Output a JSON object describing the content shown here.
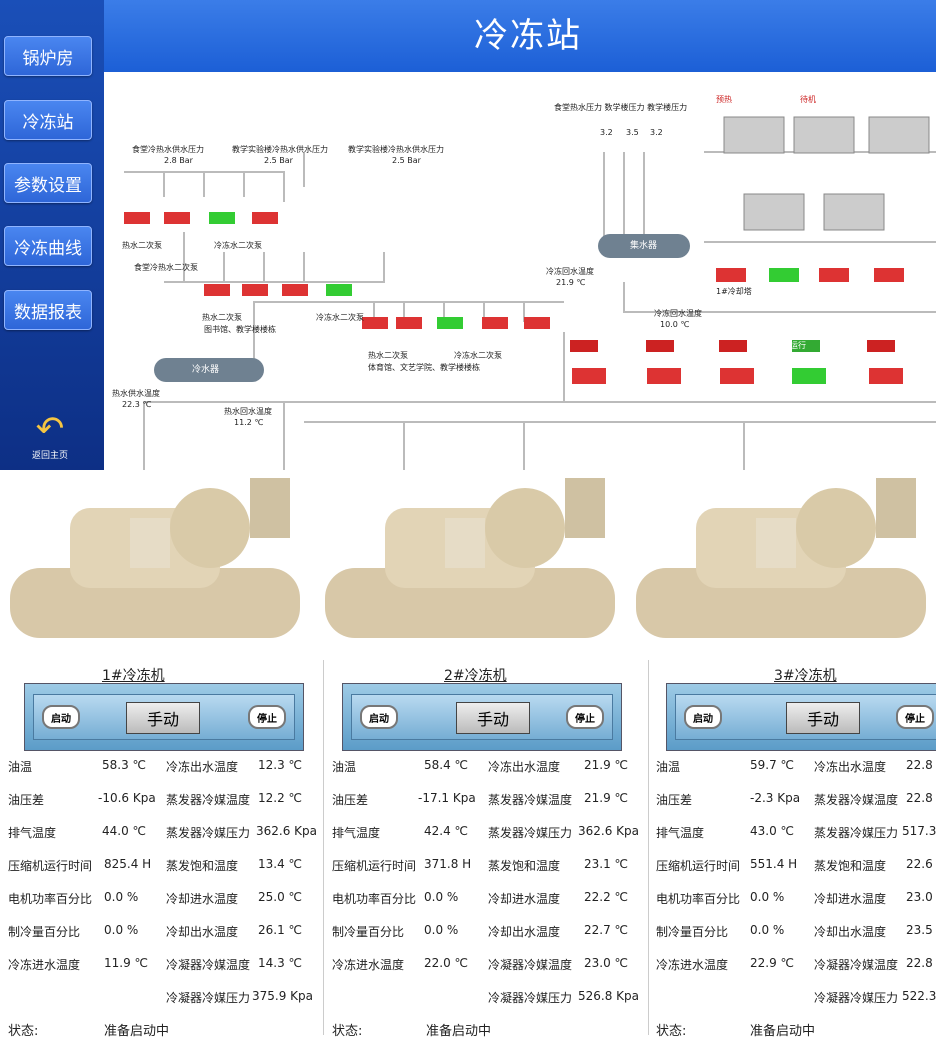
{
  "header": {
    "title": "冷冻站"
  },
  "nav": {
    "items": [
      {
        "label": "锅炉房"
      },
      {
        "label": "冷冻站"
      },
      {
        "label": "参数设置"
      },
      {
        "label": "冷冻曲线"
      },
      {
        "label": "数据报表"
      }
    ],
    "back_label": "返回主页"
  },
  "diagram": {
    "labels": {
      "cold_tank": "冷水器",
      "hot_tank": "集水器",
      "top_p1": "食堂冷热水供水压力",
      "top_p1_val": "2.8  Bar",
      "top_p2": "教学实验楼冷热水供水压力",
      "top_p2_val": "2.5  Bar",
      "top_p3": "教学实验楼冷热水供水压力",
      "top_p3_val": "2.5  Bar",
      "right_top": "食堂热水压力  数学楼压力  教学楼压力",
      "p_a": "3.2",
      "p_b": "3.5",
      "p_c": "3.2",
      "bar": "Bar",
      "pump_group1": "热水二次泵",
      "pump_group2": "冷冻水二次泵",
      "pump_group3": "食堂冷热水二次泵",
      "pump_group4": "热水二次泵",
      "pump_group5": "冷冻水二次泵",
      "pump_group6": "图书馆、教学楼楼栋",
      "pump_group7": "热水二次泵",
      "pump_group8": "冷冻水二次泵",
      "pump_group9": "体育馆、文艺学院、教学楼楼栋",
      "return_temp": "冷冻回水温度",
      "return_temp_val": "21.9 ℃",
      "supply_temp": "冷冻回水温度",
      "supply_temp_val": "10.0 ℃",
      "hot_supply": "热水供水温度",
      "hot_supply_val": "22.3 ℃",
      "hot_return": "热水回水温度",
      "hot_return_val": "11.2 ℃",
      "status_badge": "预热",
      "pump_badge": "待机",
      "pump_run": "运行",
      "cooling_tower": "1#冷却塔"
    }
  },
  "chillers": [
    {
      "title": "1#冷冻机",
      "start": "启动",
      "manual": "手动",
      "stop": "停止",
      "params_left": [
        {
          "name": "油温",
          "value": "58.3 ℃"
        },
        {
          "name": "油压差",
          "value": "-10.6 Kpa"
        },
        {
          "name": "排气温度",
          "value": "44.0 ℃"
        },
        {
          "name": "压缩机运行时间",
          "value": "825.4 H"
        },
        {
          "name": "电机功率百分比",
          "value": "0.0  %"
        },
        {
          "name": "制冷量百分比",
          "value": "0.0  %"
        },
        {
          "name": "冷冻进水温度",
          "value": "11.9 ℃"
        }
      ],
      "params_right": [
        {
          "name": "冷冻出水温度",
          "value": "12.3  ℃"
        },
        {
          "name": "蒸发器冷媒温度",
          "value": "12.2  ℃"
        },
        {
          "name": "蒸发器冷媒压力",
          "value": "362.6  Kpa"
        },
        {
          "name": "蒸发饱和温度",
          "value": "13.4  ℃"
        },
        {
          "name": "冷却进水温度",
          "value": "25.0  ℃"
        },
        {
          "name": "冷却出水温度",
          "value": "26.1  ℃"
        },
        {
          "name": "冷凝器冷媒温度",
          "value": "14.3  ℃"
        },
        {
          "name": "冷凝器冷媒压力",
          "value": "375.9  Kpa"
        }
      ],
      "status_label": "状态:",
      "status_value": "准备启动中"
    },
    {
      "title": "2#冷冻机",
      "start": "启动",
      "manual": "手动",
      "stop": "停止",
      "params_left": [
        {
          "name": "油温",
          "value": "58.4 ℃"
        },
        {
          "name": "油压差",
          "value": "-17.1 Kpa"
        },
        {
          "name": "排气温度",
          "value": "42.4 ℃"
        },
        {
          "name": "压缩机运行时间",
          "value": "371.8 H"
        },
        {
          "name": "电机功率百分比",
          "value": "0.0  %"
        },
        {
          "name": "制冷量百分比",
          "value": "0.0  %"
        },
        {
          "name": "冷冻进水温度",
          "value": "22.0 ℃"
        }
      ],
      "params_right": [
        {
          "name": "冷冻出水温度",
          "value": "21.9  ℃"
        },
        {
          "name": "蒸发器冷媒温度",
          "value": "21.9  ℃"
        },
        {
          "name": "蒸发器冷媒压力",
          "value": "362.6  Kpa"
        },
        {
          "name": "蒸发饱和温度",
          "value": "23.1  ℃"
        },
        {
          "name": "冷却进水温度",
          "value": "22.2  ℃"
        },
        {
          "name": "冷却出水温度",
          "value": "22.7  ℃"
        },
        {
          "name": "冷凝器冷媒温度",
          "value": "23.0  ℃"
        },
        {
          "name": "冷凝器冷媒压力",
          "value": "526.8  Kpa"
        }
      ],
      "status_label": "状态:",
      "status_value": "准备启动中"
    },
    {
      "title": "3#冷冻机",
      "start": "启动",
      "manual": "手动",
      "stop": "停止",
      "params_left": [
        {
          "name": "油温",
          "value": "59.7 ℃"
        },
        {
          "name": "油压差",
          "value": "-2.3 Kpa"
        },
        {
          "name": "排气温度",
          "value": "43.0 ℃"
        },
        {
          "name": "压缩机运行时间",
          "value": "551.4 H"
        },
        {
          "name": "电机功率百分比",
          "value": "0.0  %"
        },
        {
          "name": "制冷量百分比",
          "value": "0.0  %"
        },
        {
          "name": "冷冻进水温度",
          "value": "22.9 ℃"
        }
      ],
      "params_right": [
        {
          "name": "冷冻出水温度",
          "value": "22.8"
        },
        {
          "name": "蒸发器冷媒温度",
          "value": "22.8"
        },
        {
          "name": "蒸发器冷媒压力",
          "value": "517.3"
        },
        {
          "name": "蒸发饱和温度",
          "value": "22.6"
        },
        {
          "name": "冷却进水温度",
          "value": "23.0"
        },
        {
          "name": "冷却出水温度",
          "value": "23.5"
        },
        {
          "name": "冷凝器冷媒温度",
          "value": "22.8"
        },
        {
          "name": "冷凝器冷媒压力",
          "value": "522.3"
        }
      ],
      "status_label": "状态:",
      "status_value": "准备启动中"
    }
  ]
}
